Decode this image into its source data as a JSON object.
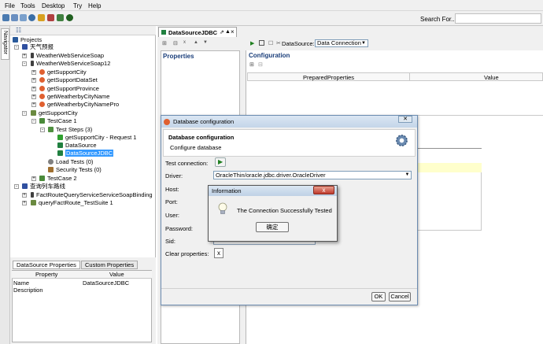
{
  "menu": [
    "File",
    "Tools",
    "Desktop",
    "Try",
    "Help"
  ],
  "search": {
    "label": "Search For..."
  },
  "nav": {
    "tab_label": "Navigator",
    "items": [
      {
        "label": "Projects",
        "icon": "projects-icon"
      },
      {
        "label": "天气预报",
        "icon": "project-icon"
      },
      {
        "label": "WeatherWebServiceSoap",
        "icon": "interface-icon"
      },
      {
        "label": "WeatherWebServiceSoap12",
        "icon": "interface-icon"
      },
      {
        "label": "getSupportCity",
        "icon": "operation-icon"
      },
      {
        "label": "getSupportDataSet",
        "icon": "operation-icon"
      },
      {
        "label": "getSupportProvince",
        "icon": "operation-icon"
      },
      {
        "label": "getWeatherbyCityName",
        "icon": "operation-icon"
      },
      {
        "label": "getWeatherbyCityNamePro",
        "icon": "operation-icon"
      },
      {
        "label": "getSupportCity",
        "icon": "testsuite-icon"
      },
      {
        "label": "TestCase 1",
        "icon": "testcase-icon"
      },
      {
        "label": "Test Steps (3)",
        "icon": "teststeps-icon"
      },
      {
        "label": "getSupportCity - Request 1",
        "icon": "request-icon"
      },
      {
        "label": "DataSource",
        "icon": "datasource-icon"
      },
      {
        "label": "DataSourceJDBC",
        "icon": "datasource-icon"
      },
      {
        "label": "Load Tests (0)",
        "icon": "loadtest-icon"
      },
      {
        "label": "Security Tests (0)",
        "icon": "securitytest-icon"
      },
      {
        "label": "TestCase 2",
        "icon": "testcase-icon"
      },
      {
        "label": "查询列车路线",
        "icon": "project-icon"
      },
      {
        "label": "FactRouteQueryServiceServiceSoapBinding",
        "icon": "interface-icon"
      },
      {
        "label": "queryFactRoute_TestSuite 1",
        "icon": "testsuite-icon"
      }
    ]
  },
  "props": {
    "tabs": [
      "DataSource Properties",
      "Custom Properties"
    ],
    "col_property": "Property",
    "col_value": "Value",
    "rows": [
      {
        "name": "Name",
        "value": "DataSourceJDBC"
      },
      {
        "name": "Description",
        "value": ""
      }
    ]
  },
  "editor": {
    "tab_title": "DataSourceJDBC",
    "datasource_label": "DataSource:",
    "datasource_value": "Data Connection",
    "properties_header": "Properties",
    "configuration_header": "Configuration",
    "col_prepared": "PreparedProperties",
    "col_value": "Value"
  },
  "dialog": {
    "title": "Database configuration",
    "heading": "Database configuration",
    "subheading": "Configure database",
    "test_connection": "Test connection:",
    "driver_label": "Driver:",
    "driver_value": "OracleThin/oracle.jdbc.driver.OracleDriver",
    "host": "Host:",
    "port": "Port:",
    "user": "User:",
    "password": "Password:",
    "sid": "Sid:",
    "clear": "Clear properties:",
    "clear_btn": "x",
    "ok": "OK",
    "cancel": "Cancel"
  },
  "info": {
    "title": "Information",
    "message": "The Connection Successfully Tested",
    "ok": "确定",
    "close": "x"
  },
  "colors": {
    "accent": "#1a3e7a",
    "selection": "#3399ff"
  }
}
